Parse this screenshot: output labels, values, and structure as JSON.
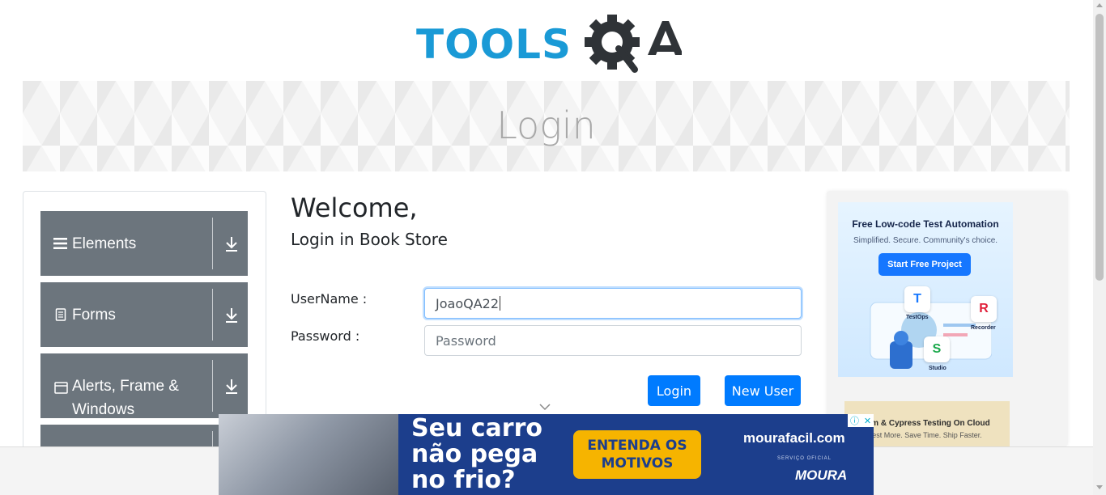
{
  "logo": {
    "text": "TOOLS",
    "qa_text": "QA",
    "brand_color": "#1a9ad6"
  },
  "banner": {
    "title": "Login"
  },
  "menu": {
    "groups": [
      {
        "label": "Elements",
        "icon": "menu-lines-icon"
      },
      {
        "label": "Forms",
        "icon": "document-icon"
      },
      {
        "label": "Alerts, Frame & Windows",
        "icon": "browser-window-icon"
      }
    ],
    "expand_icon": "download-arrow-icon",
    "bg_color": "#6c757d"
  },
  "form": {
    "welcome": "Welcome,",
    "subtitle": "Login in Book Store",
    "username_label": "UserName :",
    "username_value": "JoaoQA22",
    "password_label": "Password :",
    "password_placeholder": "Password",
    "login_button": "Login",
    "new_user_button": "New User",
    "button_color": "#007bff"
  },
  "ad_right": {
    "title": "Free Low-code Test Automation",
    "tagline": "Simplified. Secure. Community's choice.",
    "cta": "Start Free Project",
    "badges": [
      {
        "letter": "T",
        "label": "TestOps"
      },
      {
        "letter": "R",
        "label": "Recorder"
      },
      {
        "letter": "S",
        "label": "Studio"
      }
    ],
    "second_title": "ium & Cypress Testing On Cloud",
    "second_sub": "est More. Save Time. Ship Faster."
  },
  "ad_bottom": {
    "headline": "Seu carro não pega no frio?",
    "cta": "ENTENDA OS MOTIVOS",
    "site": "mourafacil.com",
    "official": "SERVIÇO OFICIAL",
    "brand": "MOURA"
  }
}
